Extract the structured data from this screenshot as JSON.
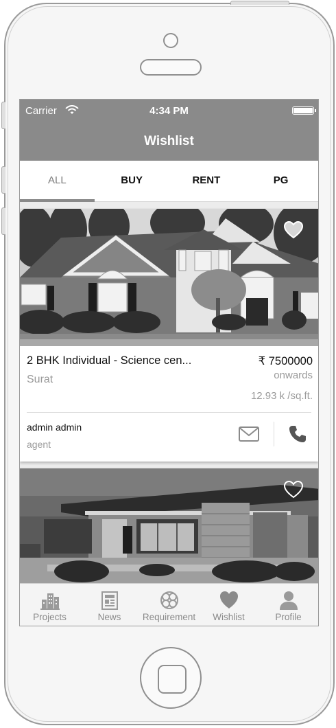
{
  "status_bar": {
    "carrier": "Carrier",
    "time": "4:34 PM"
  },
  "header": {
    "title": "Wishlist"
  },
  "tabs": [
    {
      "label": "ALL",
      "active": true
    },
    {
      "label": "BUY",
      "active": false
    },
    {
      "label": "RENT",
      "active": false
    },
    {
      "label": "PG",
      "active": false
    }
  ],
  "listings": [
    {
      "title": "2 BHK Individual - Science cen...",
      "price": "₹ 7500000",
      "price_note": "onwards",
      "city": "Surat",
      "rate": "12.93 k /sq.ft.",
      "agent_name": "admin admin",
      "agent_role": "agent",
      "favorited": true
    },
    {
      "favorited": true
    }
  ],
  "bottom_nav": [
    {
      "label": "Projects",
      "icon": "buildings-icon"
    },
    {
      "label": "News",
      "icon": "newspaper-icon"
    },
    {
      "label": "Requirement",
      "icon": "requirement-icon"
    },
    {
      "label": "Wishlist",
      "icon": "heart-icon"
    },
    {
      "label": "Profile",
      "icon": "person-icon"
    }
  ],
  "colors": {
    "bar": "#8a8a8a",
    "text": "#111111",
    "muted": "#9a9a9a"
  }
}
